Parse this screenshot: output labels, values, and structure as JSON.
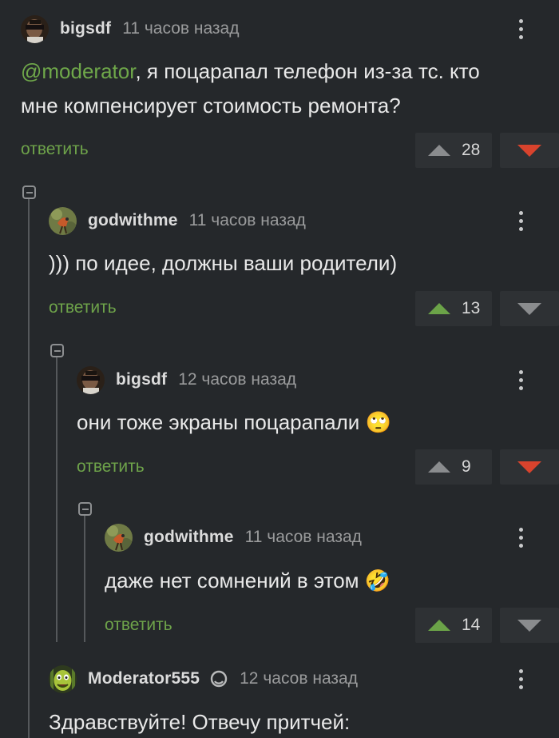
{
  "comments": [
    {
      "username": "bigsdf",
      "time": "11 часов назад",
      "mention": "@moderator",
      "text": ", я поцарапал телефон из-за тс. кто\nмне компенсирует стоимость ремонта?",
      "reply_label": "ответить",
      "votes": "28",
      "voted": "down",
      "avatar": "avatar-bigsdf"
    },
    {
      "username": "godwithme",
      "time": "11 часов назад",
      "text": "))) по идее, должны ваши родители)",
      "reply_label": "ответить",
      "votes": "13",
      "voted": "up",
      "avatar": "avatar-godwithme"
    },
    {
      "username": "bigsdf",
      "time": "12 часов назад",
      "text": "они тоже экраны поцарапали",
      "emoji": "🙄",
      "reply_label": "ответить",
      "votes": "9",
      "voted": "down",
      "avatar": "avatar-bigsdf"
    },
    {
      "username": "godwithme",
      "time": "11 часов назад",
      "text": "даже нет сомнений в этом",
      "emoji": "🤣",
      "reply_label": "ответить",
      "votes": "14",
      "voted": "up",
      "avatar": "avatar-godwithme"
    },
    {
      "username": "Moderator555",
      "time": "12 часов назад",
      "text": "Здравствуйте! Отвечу притчей:",
      "badge": "moderator-badge-icon",
      "avatar": "avatar-moderator"
    }
  ],
  "colors": {
    "background": "#25282b",
    "reply_link": "#6ea34a",
    "upvote_active": "#6ba348",
    "downvote_active": "#d8432d"
  }
}
